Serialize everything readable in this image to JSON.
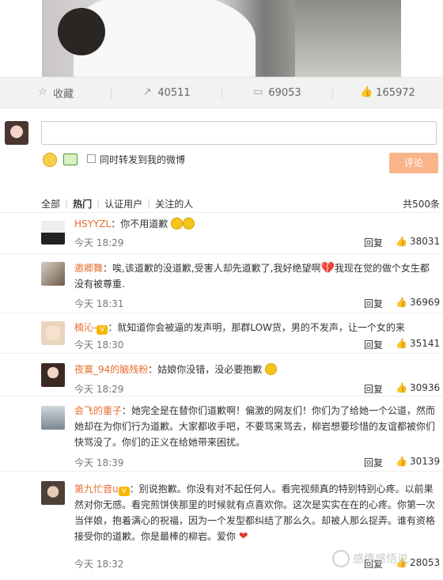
{
  "action_bar": {
    "favorite_label": "收藏",
    "repost_count": "40511",
    "comment_count": "69053",
    "like_count": "165972"
  },
  "compose": {
    "repost_label": "同时转发到我的微博",
    "submit_label": "评论"
  },
  "filters": {
    "items": [
      "全部",
      "热门",
      "认证用户",
      "关注的人"
    ],
    "active": "热门",
    "total": "共500条"
  },
  "comments": [
    {
      "user": "HSYYZL",
      "text": "：你不用道歉",
      "time": "今天 18:29",
      "reply": "回复",
      "likes": "38031"
    },
    {
      "user": "邀卿舞",
      "text": "：唉,该道歉的没道歉,受害人却先道歉了,我好绝望啊",
      "text2": "我现在觉的做个女生都没有被尊重.",
      "time": "今天 18:31",
      "reply": "回复",
      "likes": "36969"
    },
    {
      "user": "楠沁-",
      "text": "：就知道你会被逼的发声明，那群LOW货，男的不发声，让一个女的来",
      "time": "今天 18:30",
      "reply": "回复",
      "likes": "35141"
    },
    {
      "user": "夜寞_94的脑残粉",
      "text": "：姑娘你没错，没必要抱歉",
      "time": "今天 18:29",
      "reply": "回复",
      "likes": "30936"
    },
    {
      "user": "会飞的重子",
      "text": "：她完全是在替你们道歉啊！偏激的网友们！你们为了给她一个公道，然而她却在为你们行为道歉。大家都收手吧，不要骂来骂去，柳岩想要珍惜的友谊都被你们快骂没了。你们的正义在给她带来困扰。",
      "time": "今天 18:39",
      "reply": "回复",
      "likes": "30139"
    },
    {
      "user": "第九忙音u",
      "text": "：别说抱歉。你没有对不起任何人。看完视频真的特别特别心疼。以前果然对你无感。看完煎饼侠那里的时候就有点喜欢你。这次是实实在在的心疼。你第一次当伴娘，抱着满心的祝福，因为一个发型都纠结了那么久。却被人那么捉弄。谁有资格接受你的道歉。你是最棒的柳岩。爱你",
      "time": "今天 18:32",
      "reply": "回复",
      "likes": "28053"
    }
  ],
  "watermark": "感情感悟说"
}
